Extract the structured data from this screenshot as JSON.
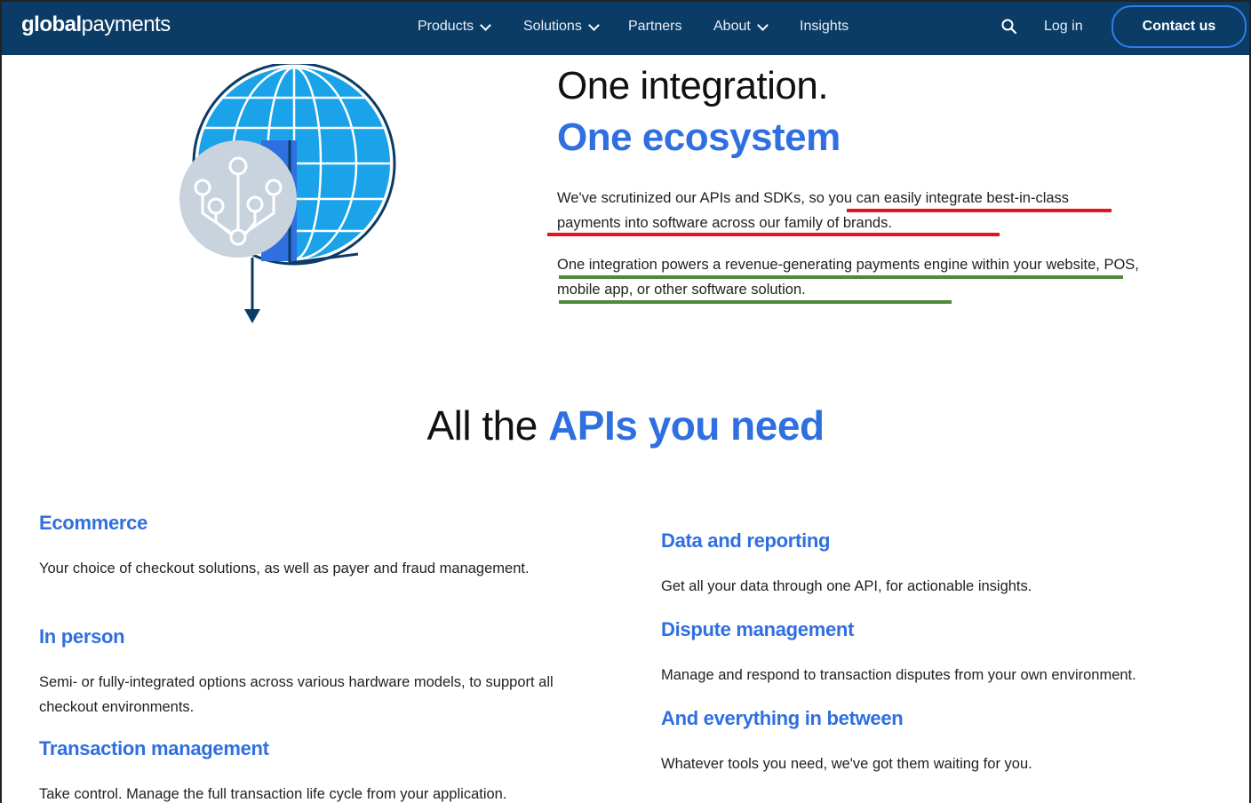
{
  "nav": {
    "logo_bold": "global",
    "logo_light": "payments",
    "items": [
      {
        "label": "Products",
        "dropdown": true
      },
      {
        "label": "Solutions",
        "dropdown": true
      },
      {
        "label": "Partners",
        "dropdown": false
      },
      {
        "label": "About",
        "dropdown": true
      },
      {
        "label": "Insights",
        "dropdown": false
      }
    ],
    "search_icon": "search-icon",
    "login_label": "Log in",
    "contact_label": "Contact us"
  },
  "hero": {
    "title_line1": "One integration.",
    "title_line2": "One ecosystem",
    "paragraph1": "We've scrutinized our APIs and SDKs, so you can easily integrate best-in-class payments into software across our family of brands.",
    "paragraph2": "One integration powers a revenue-generating payments engine within your website, POS, mobile app, or other software solution."
  },
  "apis": {
    "title_plain": "All the ",
    "title_accent": "APIs you need",
    "features": [
      {
        "heading": "Ecommerce",
        "text": "Your choice of checkout solutions, as well as payer and fraud management."
      },
      {
        "heading": "In person",
        "text": "Semi- or fully-integrated options across various hardware models, to support all checkout environments."
      },
      {
        "heading": "Transaction management",
        "text": "Take control. Manage the full transaction life cycle from your application."
      },
      {
        "heading": "Data and reporting",
        "text": "Get all your data through one API, for actionable insights."
      },
      {
        "heading": "Dispute management",
        "text": "Manage and respond to transaction disputes from your own environment."
      },
      {
        "heading": "And everything in between",
        "text": "Whatever tools you need, we've got them waiting for you."
      }
    ]
  },
  "colors": {
    "nav_bg": "#0b3c66",
    "accent_blue": "#2f6fe0",
    "highlight_red": "#e8121a",
    "highlight_green": "#4f8a3a",
    "globe_blue": "#1aa3e8"
  }
}
